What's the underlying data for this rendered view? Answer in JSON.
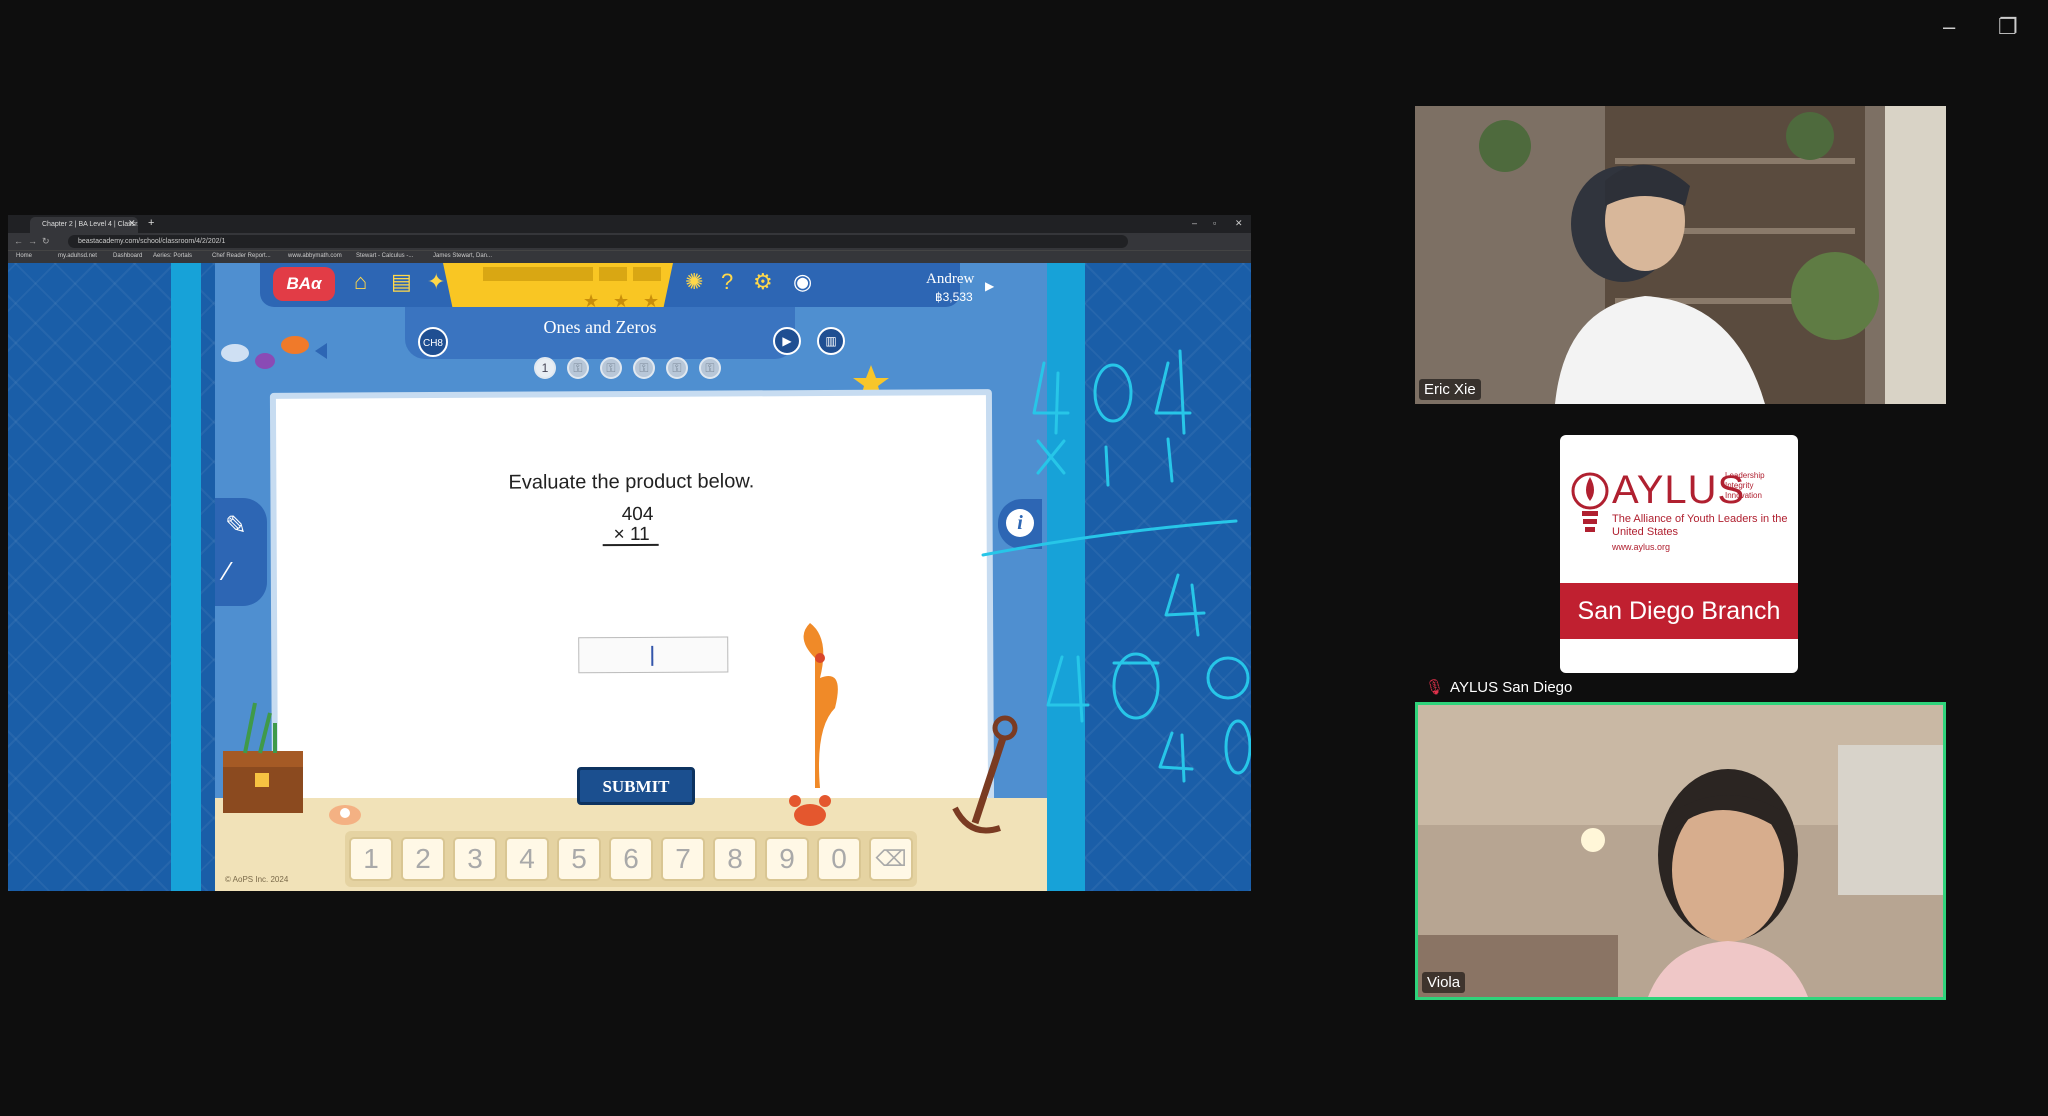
{
  "window": {
    "minimize_icon": "–",
    "restore_icon": "❐"
  },
  "browser": {
    "tab_title": "Chapter 2 | BA Level 4 | Classr...",
    "tab_close": "✕",
    "new_tab": "+",
    "url": "beastacademy.com/school/classroom/4/2/202/1",
    "bookmarks": [
      "Home",
      "my.aduhsd.net",
      "Dashboard",
      "Aeries: Portals",
      "Chef Reader Report...",
      "www.abbymath.com",
      "Stewart - Calculus -...",
      "James Stewart, Dan..."
    ]
  },
  "game": {
    "bao_logo": "BAα",
    "user_name": "Andrew",
    "coins": "฿3,533",
    "chapter_badge": "CH8",
    "lesson_title": "Ones and Zeros",
    "progress": [
      "1",
      "",
      "",
      "",
      "",
      ""
    ],
    "question": "Evaluate the product below.",
    "multiplicand": "404",
    "multiplier": "×  11",
    "answer_value": "",
    "submit_label": "SUBMIT",
    "keypad": [
      "1",
      "2",
      "3",
      "4",
      "5",
      "6",
      "7",
      "8",
      "9",
      "0",
      "⌫"
    ],
    "copyright": "© AoPS Inc. 2024"
  },
  "participants": [
    {
      "name": "Eric Xie",
      "kind": "video"
    },
    {
      "name": "AYLUS San Diego",
      "kind": "logo",
      "muted": true
    },
    {
      "name": "Viola",
      "kind": "video",
      "active_speaker": true
    }
  ],
  "aylus_logo": {
    "title": "AYLUS",
    "side_lines": [
      "Leadership",
      "Integrity",
      "Innovation"
    ],
    "subtitle": "The Alliance of Youth Leaders in the United States",
    "url": "www.aylus.org",
    "branch": "San Diego Branch"
  },
  "colors": {
    "active_speaker_border": "#2fd37b",
    "annotation_ink": "#27c6e8",
    "submit_button": "#1b4f8f"
  }
}
